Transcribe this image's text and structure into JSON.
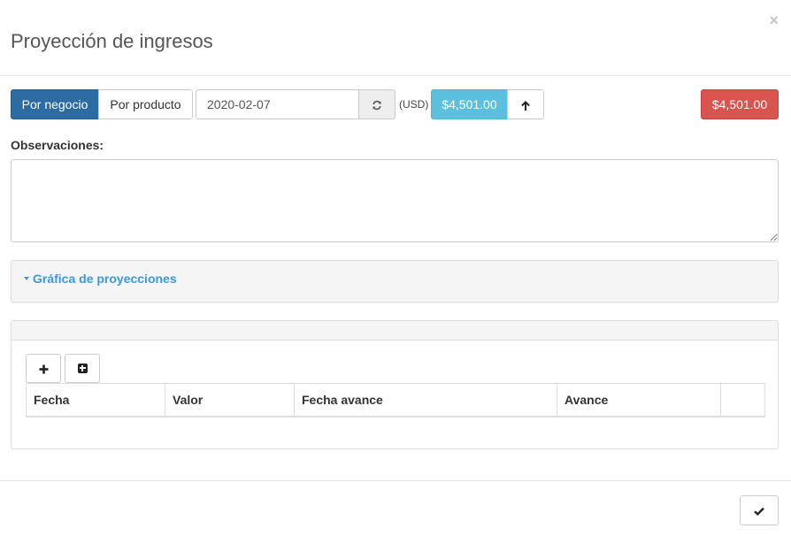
{
  "modal": {
    "title": "Proyección de ingresos",
    "close_symbol": "×"
  },
  "toolbar": {
    "by_business_label": "Por negocio",
    "by_product_label": "Por producto",
    "date_value": "2020-02-07",
    "refresh_icon": "refresh-icon",
    "currency_label": "(USD)",
    "amount_info": "$4,501.00",
    "arrow_icon": "arrow-up-icon",
    "amount_total": "$4,501.00"
  },
  "observations": {
    "label": "Observaciones:",
    "value": ""
  },
  "chart_panel": {
    "title": "Gráfica de proyecciones"
  },
  "table_panel": {
    "add_icon": "plus-icon",
    "add_square_icon": "plus-square-icon",
    "columns": [
      "Fecha",
      "Valor",
      "Fecha avance",
      "Avance",
      ""
    ]
  },
  "footer": {
    "confirm_icon": "check-icon"
  },
  "colors": {
    "primary": "#2c6ca3",
    "info": "#5bc0de",
    "danger": "#d9534f",
    "link": "#3a9ad9"
  }
}
